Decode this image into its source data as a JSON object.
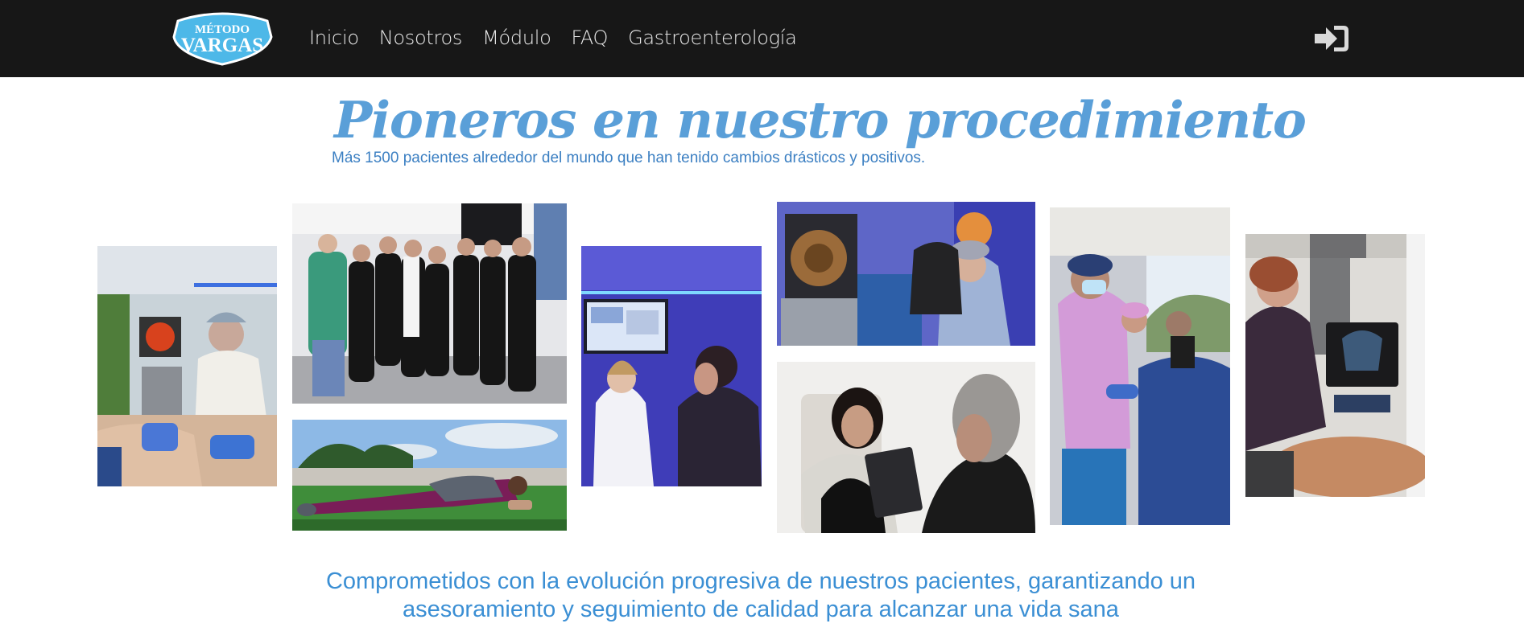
{
  "header": {
    "logo": {
      "line1": "MÉTODO",
      "line2": "VARGAS"
    },
    "nav": [
      {
        "label": "Inicio"
      },
      {
        "label": "Nosotros"
      },
      {
        "label": "Módulo"
      },
      {
        "label": "FAQ"
      },
      {
        "label": "Gastroenterología"
      }
    ],
    "login_icon": "sign-in-icon"
  },
  "hero": {
    "title": "Pioneros en nuestro procedimiento",
    "subtitle": "Más 1500 pacientes alrededor del mundo que han tenido cambios drásticos y positivos."
  },
  "gallery": {
    "photos": [
      {
        "name": "photo-endoscopy-procedure"
      },
      {
        "name": "photo-team-group"
      },
      {
        "name": "photo-plank-exercise"
      },
      {
        "name": "photo-doctor-patient-consult"
      },
      {
        "name": "photo-endoscopy-monitor"
      },
      {
        "name": "photo-tablet-consultation"
      },
      {
        "name": "photo-nurses-procedure"
      },
      {
        "name": "photo-ultrasound-exam"
      }
    ]
  },
  "tagline": {
    "line1": "Comprometidos con la evolución progresiva de nuestros pacientes, garantizando un",
    "line2": "asesoramiento y seguimiento de calidad para alcanzar una vida sana"
  },
  "colors": {
    "header_bg": "#171717",
    "accent_blue": "#5a9fd8",
    "text_blue": "#3b8fd4"
  }
}
